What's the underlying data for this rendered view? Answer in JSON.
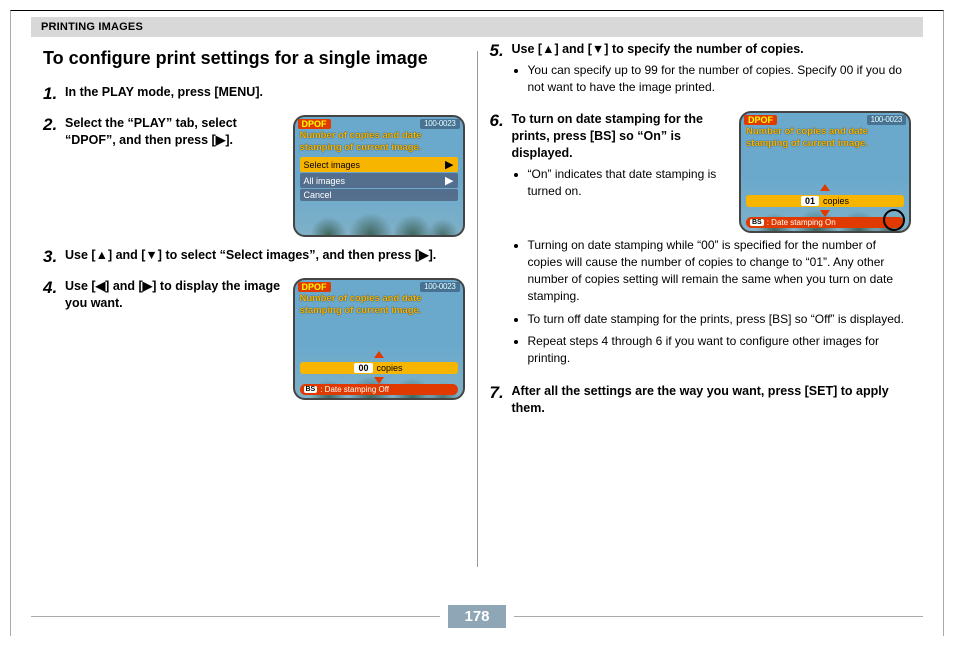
{
  "header": {
    "title": "PRINTING IMAGES"
  },
  "section_title": "To configure print settings for a single image",
  "steps": {
    "s1": {
      "text": "In the PLAY mode, press [MENU]."
    },
    "s2": {
      "text": "Select the “PLAY” tab, select “DPOF”, and then press [▶]."
    },
    "s3": {
      "text": "Use [▲] and [▼] to select “Select images”, and then press [▶]."
    },
    "s4": {
      "text": "Use [◀] and [▶] to display the image you want."
    },
    "s5": {
      "head": "Use [▲] and [▼] to specify the number of copies.",
      "b1": "You can specify up to 99 for the number of copies. Specify 00 if you do not want to have the image printed."
    },
    "s6": {
      "head": "To turn on date stamping for the prints, press [BS] so “On” is displayed.",
      "b1": "“On” indicates that date stamping is turned on.",
      "b2": "Turning on date stamping while “00” is specified for the number of copies will cause the number of copies to change to “01”. Any other number of copies setting will remain the same when you turn on date stamping.",
      "b3": "To turn off date stamping for the prints, press [BS] so “Off” is displayed.",
      "b4": "Repeat steps 4 through 6 if you want to configure other images for printing."
    },
    "s7": {
      "head": "After all the settings are the way you want, press [SET] to apply them."
    }
  },
  "lcd": {
    "dpof": "DPOF",
    "file_id": "100-0023",
    "msg1": "Number of copies and date stamping of current image.",
    "menu_select": "Select images",
    "menu_all": "All images",
    "menu_cancel": "Cancel",
    "copies_label": "copies",
    "copies_00": "00",
    "copies_01": "01",
    "bs": "BS",
    "stamp_off": ": Date stamping Off",
    "stamp_on": ": Date stamping On"
  },
  "page_number": "178"
}
